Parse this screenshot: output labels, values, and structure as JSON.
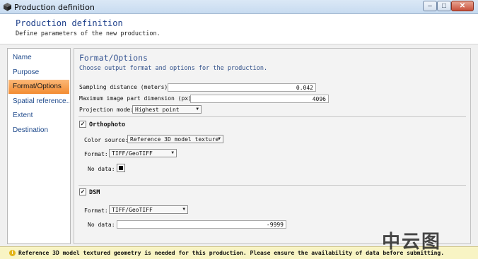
{
  "window": {
    "title": "Production definition",
    "controls": {
      "minimize": "–",
      "maximize": "□",
      "close": "✕"
    }
  },
  "header": {
    "title": "Production definition",
    "subtitle": "Define parameters of the new production."
  },
  "sidebar": {
    "items": [
      {
        "label": "Name",
        "active": false
      },
      {
        "label": "Purpose",
        "active": false
      },
      {
        "label": "Format/Options",
        "active": true
      },
      {
        "label": "Spatial reference...",
        "active": false
      },
      {
        "label": "Extent",
        "active": false
      },
      {
        "label": "Destination",
        "active": false
      }
    ]
  },
  "panel": {
    "title": "Format/Options",
    "subtitle": "Choose output format and options for the production.",
    "sampling": {
      "label": "Sampling distance (meters):",
      "value": "0.042"
    },
    "max_image": {
      "label": "Maximum image part dimension (px):",
      "value": "4096"
    },
    "projection": {
      "label": "Projection mode:",
      "value": "Highest point"
    },
    "orthophoto": {
      "title": "Orthophoto",
      "checked": true,
      "color_source": {
        "label": "Color source:",
        "value": "Reference 3D model texture"
      },
      "format": {
        "label": "Format:",
        "value": "TIFF/GeoTIFF"
      },
      "nodata": {
        "label": "No data:",
        "color": "#000000"
      }
    },
    "dsm": {
      "title": "DSM",
      "checked": true,
      "format": {
        "label": "Format:",
        "value": "TIFF/GeoTIFF"
      },
      "nodata": {
        "label": "No data:",
        "value": "-9999"
      }
    }
  },
  "status": {
    "icon": "info-icon",
    "message": "Reference 3D model textured geometry is needed for this production. Please ensure the availability of data before submitting."
  },
  "watermark": "中云图",
  "colors": {
    "accent_active": "#f38c32",
    "header_title": "#1d3f8a",
    "nav_link": "#1f4a8c",
    "status_bg": "#f8f4c4"
  }
}
